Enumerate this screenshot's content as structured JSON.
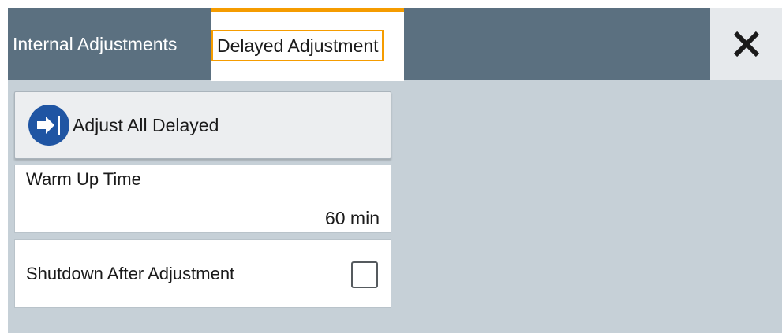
{
  "tabs": {
    "internal_label": "Internal Adjustments",
    "delayed_label": "Delayed Adjustment"
  },
  "close": {
    "icon": "close-icon"
  },
  "adjust_all": {
    "label": "Adjust All Delayed",
    "icon": "arrow-right-bar-icon"
  },
  "warm_up": {
    "label": "Warm Up Time",
    "value": "60 min"
  },
  "shutdown": {
    "label": "Shutdown After Adjustment",
    "checked": false
  },
  "colors": {
    "tab_bar": "#5b7080",
    "active_tab_accent": "#f59c00",
    "panel_background": "#c6d0d7",
    "icon_circle": "#1f55a3"
  }
}
